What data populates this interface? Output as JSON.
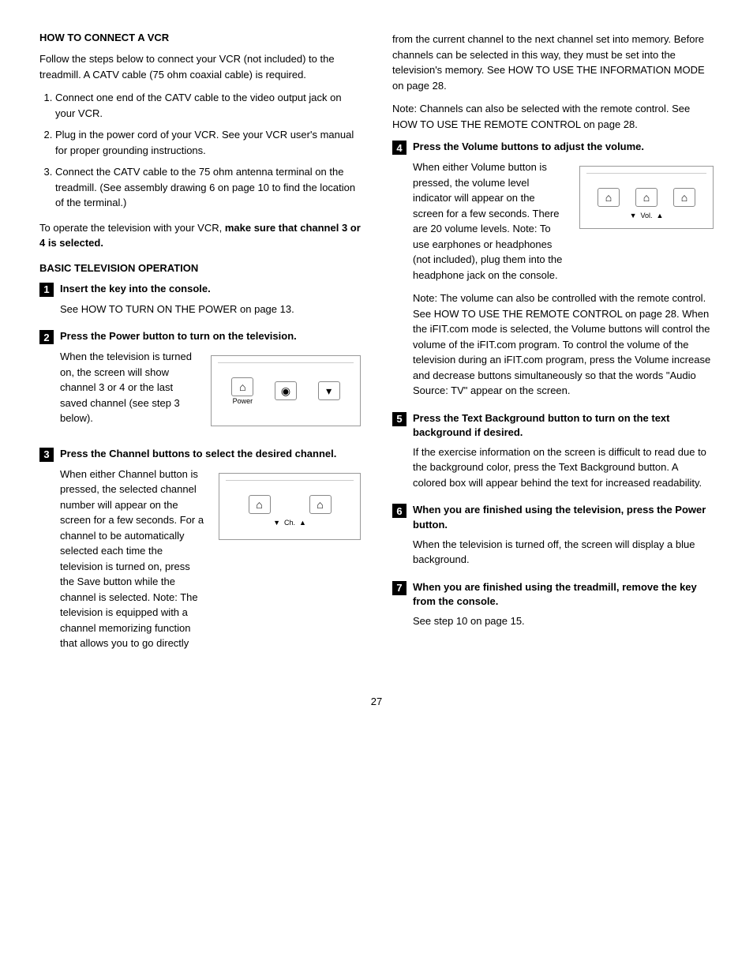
{
  "page": {
    "number": "27",
    "left_column": {
      "section1": {
        "title": "HOW TO CONNECT A VCR",
        "intro": "Follow the steps below to connect your VCR (not included) to the treadmill. A CATV cable (75 ohm coaxial cable) is required.",
        "steps": [
          "Connect one end of the CATV cable to the video output jack on your VCR.",
          "Plug in the power cord of your VCR. See your VCR user's manual for proper grounding instructions.",
          "Connect the CATV cable to the 75 ohm antenna terminal on the treadmill. (See assembly drawing 6 on page 10 to find the location of the terminal.)"
        ],
        "note": "To operate the television with your VCR, ",
        "note_bold": "make sure that channel 3 or 4 is selected."
      },
      "section2": {
        "title": "BASIC TELEVISION OPERATION",
        "steps": [
          {
            "num": "1",
            "title": "Insert the key into the console.",
            "body": "See HOW TO TURN ON THE POWER on page 13."
          },
          {
            "num": "2",
            "title": "Press the Power button to turn on the television.",
            "body": "When the television is turned on, the screen will show channel 3 or 4 or the last saved channel (see step 3 below).",
            "has_diagram": true,
            "diagram_buttons": [
              "power",
              "channel",
              "arrow_down"
            ],
            "diagram_labels": [
              "Power",
              "◉",
              "▼"
            ]
          },
          {
            "num": "3",
            "title": "Press the Channel buttons to select the desired channel.",
            "body": "When either Channel button is pressed, the selected channel number will appear on the screen for a few seconds. For a channel to be automatically selected each time the television is turned on, press the Save button while the channel is selected. Note: The television is equipped with a channel memorizing function that allows you to go directly",
            "has_diagram": true,
            "diagram_buttons": [
              "ch_down",
              "ch_up"
            ],
            "diagram_labels": [
              "▼  Ch.  ▲"
            ]
          }
        ]
      }
    },
    "right_column": {
      "continuation": "from the current channel to the next channel set into memory. Before channels can be selected in this way, they must be set into the television's memory. See HOW TO USE THE INFORMATION MODE on page 28.",
      "note_channels": "Note: Channels can also be selected with the remote control. See HOW TO USE THE REMOTE CONTROL on page 28.",
      "steps": [
        {
          "num": "4",
          "title": "Press the Volume buttons to adjust the volume.",
          "body": "When either Volume button is pressed, the volume level indicator will appear on the screen for a few seconds. There are 20 volume levels. Note: To use earphones or headphones (not included), plug them into the headphone jack on the console.",
          "note": "Note: The volume can also be controlled with the remote control. See HOW TO USE THE REMOTE CONTROL on page 28. When the iFIT.com mode is selected, the Volume buttons will control the volume of the iFIT.com program. To control the volume of the television during an iFIT.com program, press the Volume increase and decrease buttons simultaneously so that the words \"Audio Source: TV\" appear on the screen.",
          "has_diagram": true,
          "diagram_labels": [
            "▼  Vol.  ▲"
          ]
        },
        {
          "num": "5",
          "title": "Press the Text Background button to turn on the text background if desired.",
          "body": "If the exercise information on the screen is difficult to read due to the background color, press the Text Background button. A colored box will appear behind the text for increased readability."
        },
        {
          "num": "6",
          "title": "When you are finished using the television, press the Power button.",
          "body": "When the television is turned off, the screen will display a blue background."
        },
        {
          "num": "7",
          "title": "When you are finished using the treadmill, remove the key from the console.",
          "body": "See step 10 on page 15."
        }
      ]
    }
  }
}
